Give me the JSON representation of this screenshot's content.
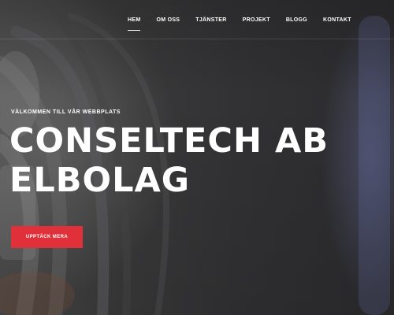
{
  "nav": {
    "items": [
      {
        "label": "HEM",
        "active": true
      },
      {
        "label": "OM OSS",
        "active": false
      },
      {
        "label": "TJÄNSTER",
        "active": false
      },
      {
        "label": "PROJEKT",
        "active": false
      },
      {
        "label": "BLOGG",
        "active": false
      },
      {
        "label": "KONTAKT",
        "active": false
      }
    ]
  },
  "hero": {
    "welcome": "VÄLKOMMEN TILL VÅR WEBBPLATS",
    "title_line1": "CONSELTECH AB",
    "title_line2": "ELBOLAG",
    "cta_label": "UPPTÄCK MERA"
  },
  "colors": {
    "accent": "#e0313a",
    "text": "#ffffff",
    "background": "#2c2c2e"
  }
}
